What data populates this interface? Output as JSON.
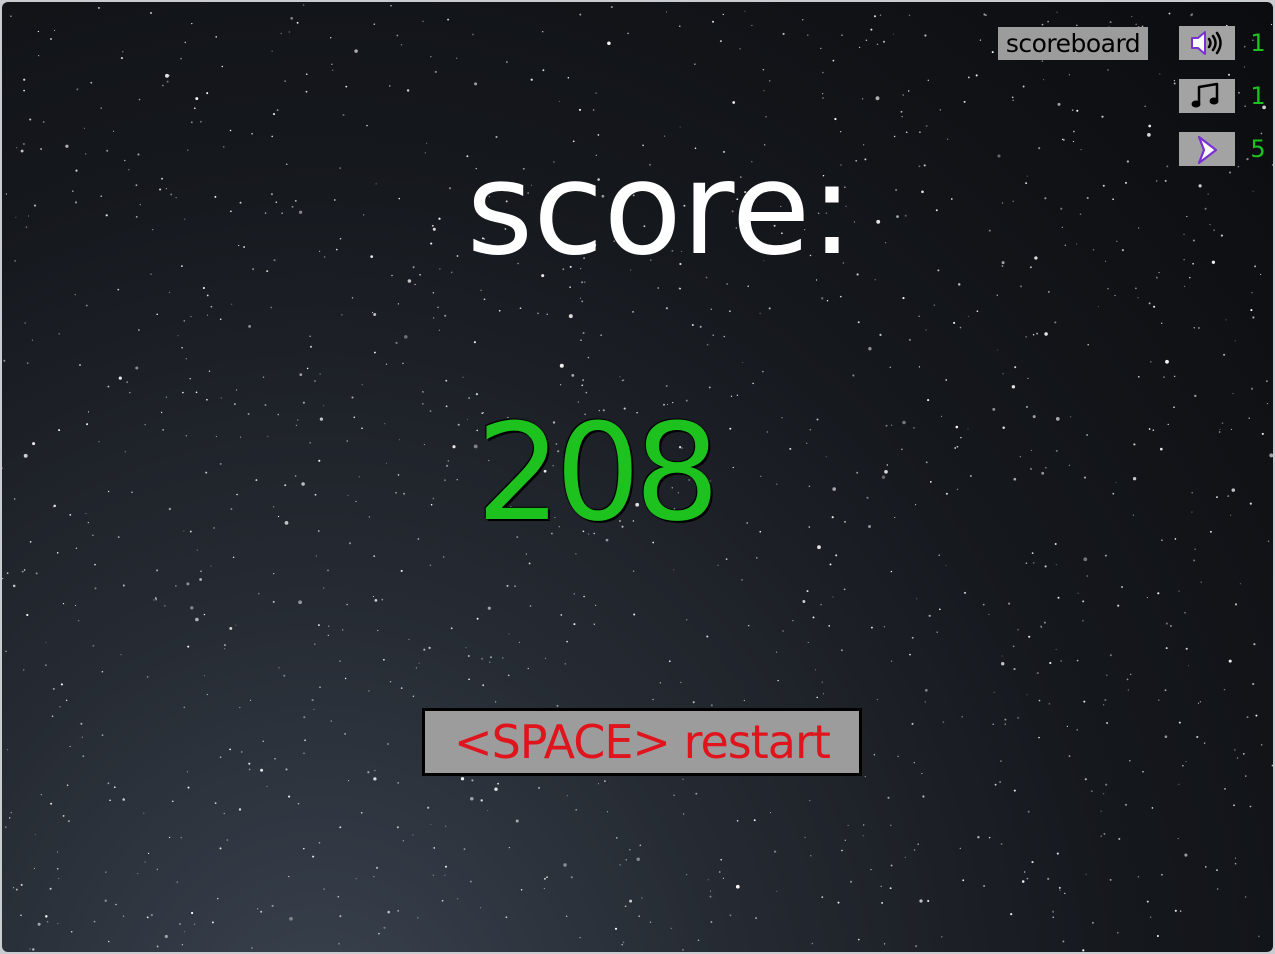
{
  "game": {
    "score_label": "score:",
    "score_value": "208",
    "restart_label": "<SPACE> restart"
  },
  "controls": {
    "scoreboard_label": "scoreboard",
    "sound": {
      "icon": "speaker-icon",
      "value": "1"
    },
    "music": {
      "icon": "music-note-icon",
      "value": "1"
    },
    "speed": {
      "icon": "arrow-cursor-icon",
      "value": "5"
    }
  },
  "colors": {
    "score_value": "#1ec21e",
    "restart_text": "#e0141c",
    "button_bg": "#9c9c9c",
    "icon_accent": "#7b2fd6",
    "control_values": "#1ec21e"
  }
}
